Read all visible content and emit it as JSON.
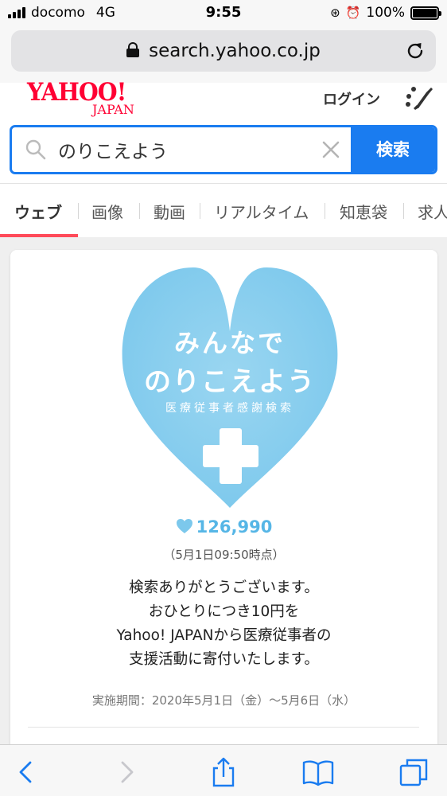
{
  "status_bar": {
    "carrier": "docomo",
    "network": "4G",
    "time": "9:55",
    "battery": "100%"
  },
  "browser": {
    "url": "search.yahoo.co.jp"
  },
  "header": {
    "logo_main": "YAHOO!",
    "logo_sub": "JAPAN",
    "login": "ログイン"
  },
  "search": {
    "query": "のりこえよう",
    "button": "検索"
  },
  "tabs": [
    "ウェブ",
    "画像",
    "動画",
    "リアルタイム",
    "知恵袋",
    "求人"
  ],
  "campaign": {
    "heart_line1": "みんなで",
    "heart_line2": "のりこえよう",
    "heart_line3": "医療従事者感謝検索",
    "count": "126,990",
    "count_time": "（5月1日09:50時点）",
    "message": [
      "検索ありがとうございます。",
      "おひとりにつき10円を",
      "Yahoo! JAPANから医療従事者の",
      "支援活動に寄付いたします。"
    ],
    "period": "実施期間：2020年5月1日（金）〜5月6日（水）"
  },
  "colors": {
    "brand_red": "#ff0033",
    "search_blue": "#1a7cf0",
    "heart_blue": "#8fd0ef",
    "tab_underline": "#ff4a59"
  }
}
